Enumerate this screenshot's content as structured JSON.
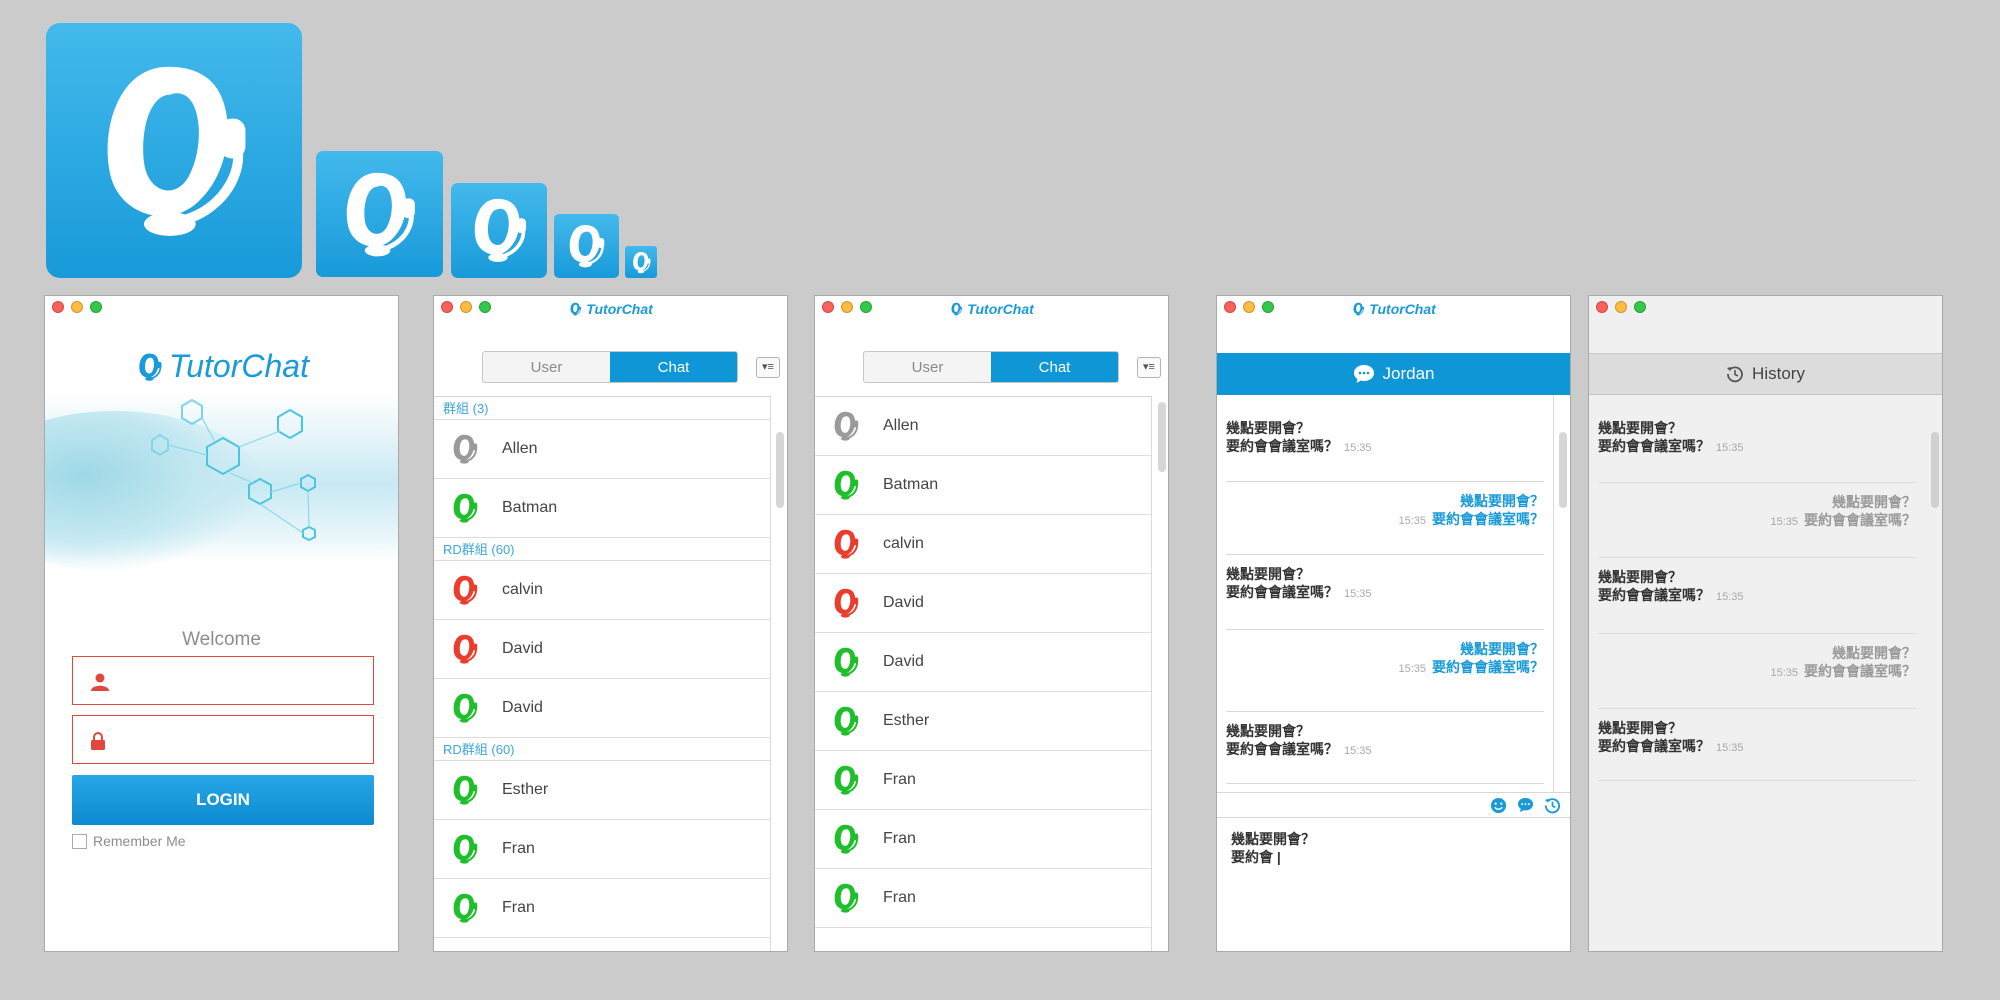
{
  "colors": {
    "brand": "#1a9ad8",
    "online": "#1fbf2b",
    "busy": "#ea3d2d",
    "offline": "#9a9a9a",
    "error_border": "#e0483d",
    "background": "#cbcbcb"
  },
  "app_name": "TutorChat",
  "app_icon": "tutorchat-headset-icon",
  "login": {
    "welcome": "Welcome",
    "username_placeholder": "",
    "password_placeholder": "",
    "button": "LOGIN",
    "remember": "Remember Me"
  },
  "tabs": {
    "user": "User",
    "chat": "Chat",
    "active": "Chat"
  },
  "grouped_list": {
    "groups": [
      {
        "label": "群組 (3)",
        "members": [
          {
            "name": "Allen",
            "status": "offline"
          },
          {
            "name": "Batman",
            "status": "online"
          }
        ]
      },
      {
        "label": "RD群組 (60)",
        "members": [
          {
            "name": "calvin",
            "status": "busy"
          },
          {
            "name": "David",
            "status": "busy"
          },
          {
            "name": "David",
            "status": "online"
          }
        ]
      },
      {
        "label": "RD群組 (60)",
        "members": [
          {
            "name": "Esther",
            "status": "online"
          },
          {
            "name": "Fran",
            "status": "online"
          },
          {
            "name": "Fran",
            "status": "online"
          }
        ]
      }
    ]
  },
  "flat_list": [
    {
      "name": "Allen",
      "status": "offline"
    },
    {
      "name": "Batman",
      "status": "online"
    },
    {
      "name": "calvin",
      "status": "busy"
    },
    {
      "name": "David",
      "status": "busy"
    },
    {
      "name": "David",
      "status": "online"
    },
    {
      "name": "Esther",
      "status": "online"
    },
    {
      "name": "Fran",
      "status": "online"
    },
    {
      "name": "Fran",
      "status": "online"
    },
    {
      "name": "Fran",
      "status": "online"
    }
  ],
  "chat": {
    "header": "Jordan",
    "header_icon": "chat-bubble-icon",
    "messages": [
      {
        "dir": "in",
        "line1": "幾點要開會？",
        "line2": "要約會會議室嗎？",
        "time": "15:35"
      },
      {
        "dir": "out",
        "line1": "幾點要開會？",
        "line2": "要約會會議室嗎？",
        "time": "15:35"
      },
      {
        "dir": "in",
        "line1": "幾點要開會？",
        "line2": "要約會會議室嗎？",
        "time": "15:35"
      },
      {
        "dir": "out",
        "line1": "幾點要開會？",
        "line2": "要約會會議室嗎？",
        "time": "15:35"
      },
      {
        "dir": "in",
        "line1": "幾點要開會？",
        "line2": "要約會會議室嗎？",
        "time": "15:35"
      }
    ],
    "toolbar": [
      "emoji-icon",
      "chat-icon",
      "history-icon"
    ],
    "compose_line1": "幾點要開會？",
    "compose_line2": "要約會 |"
  },
  "history": {
    "header": "History",
    "header_icon": "history-icon",
    "messages": [
      {
        "dir": "in",
        "line1": "幾點要開會？",
        "line2": "要約會會議室嗎？",
        "time": "15:35"
      },
      {
        "dir": "out",
        "line1": "幾點要開會？",
        "line2": "要約會會議室嗎？",
        "time": "15:35"
      },
      {
        "dir": "in",
        "line1": "幾點要開會？",
        "line2": "要約會會議室嗎？",
        "time": "15:35"
      },
      {
        "dir": "out",
        "line1": "幾點要開會？",
        "line2": "要約會會議室嗎？",
        "time": "15:35"
      },
      {
        "dir": "in",
        "line1": "幾點要開會？",
        "line2": "要約會會議室嗎？",
        "time": "15:35"
      }
    ]
  }
}
